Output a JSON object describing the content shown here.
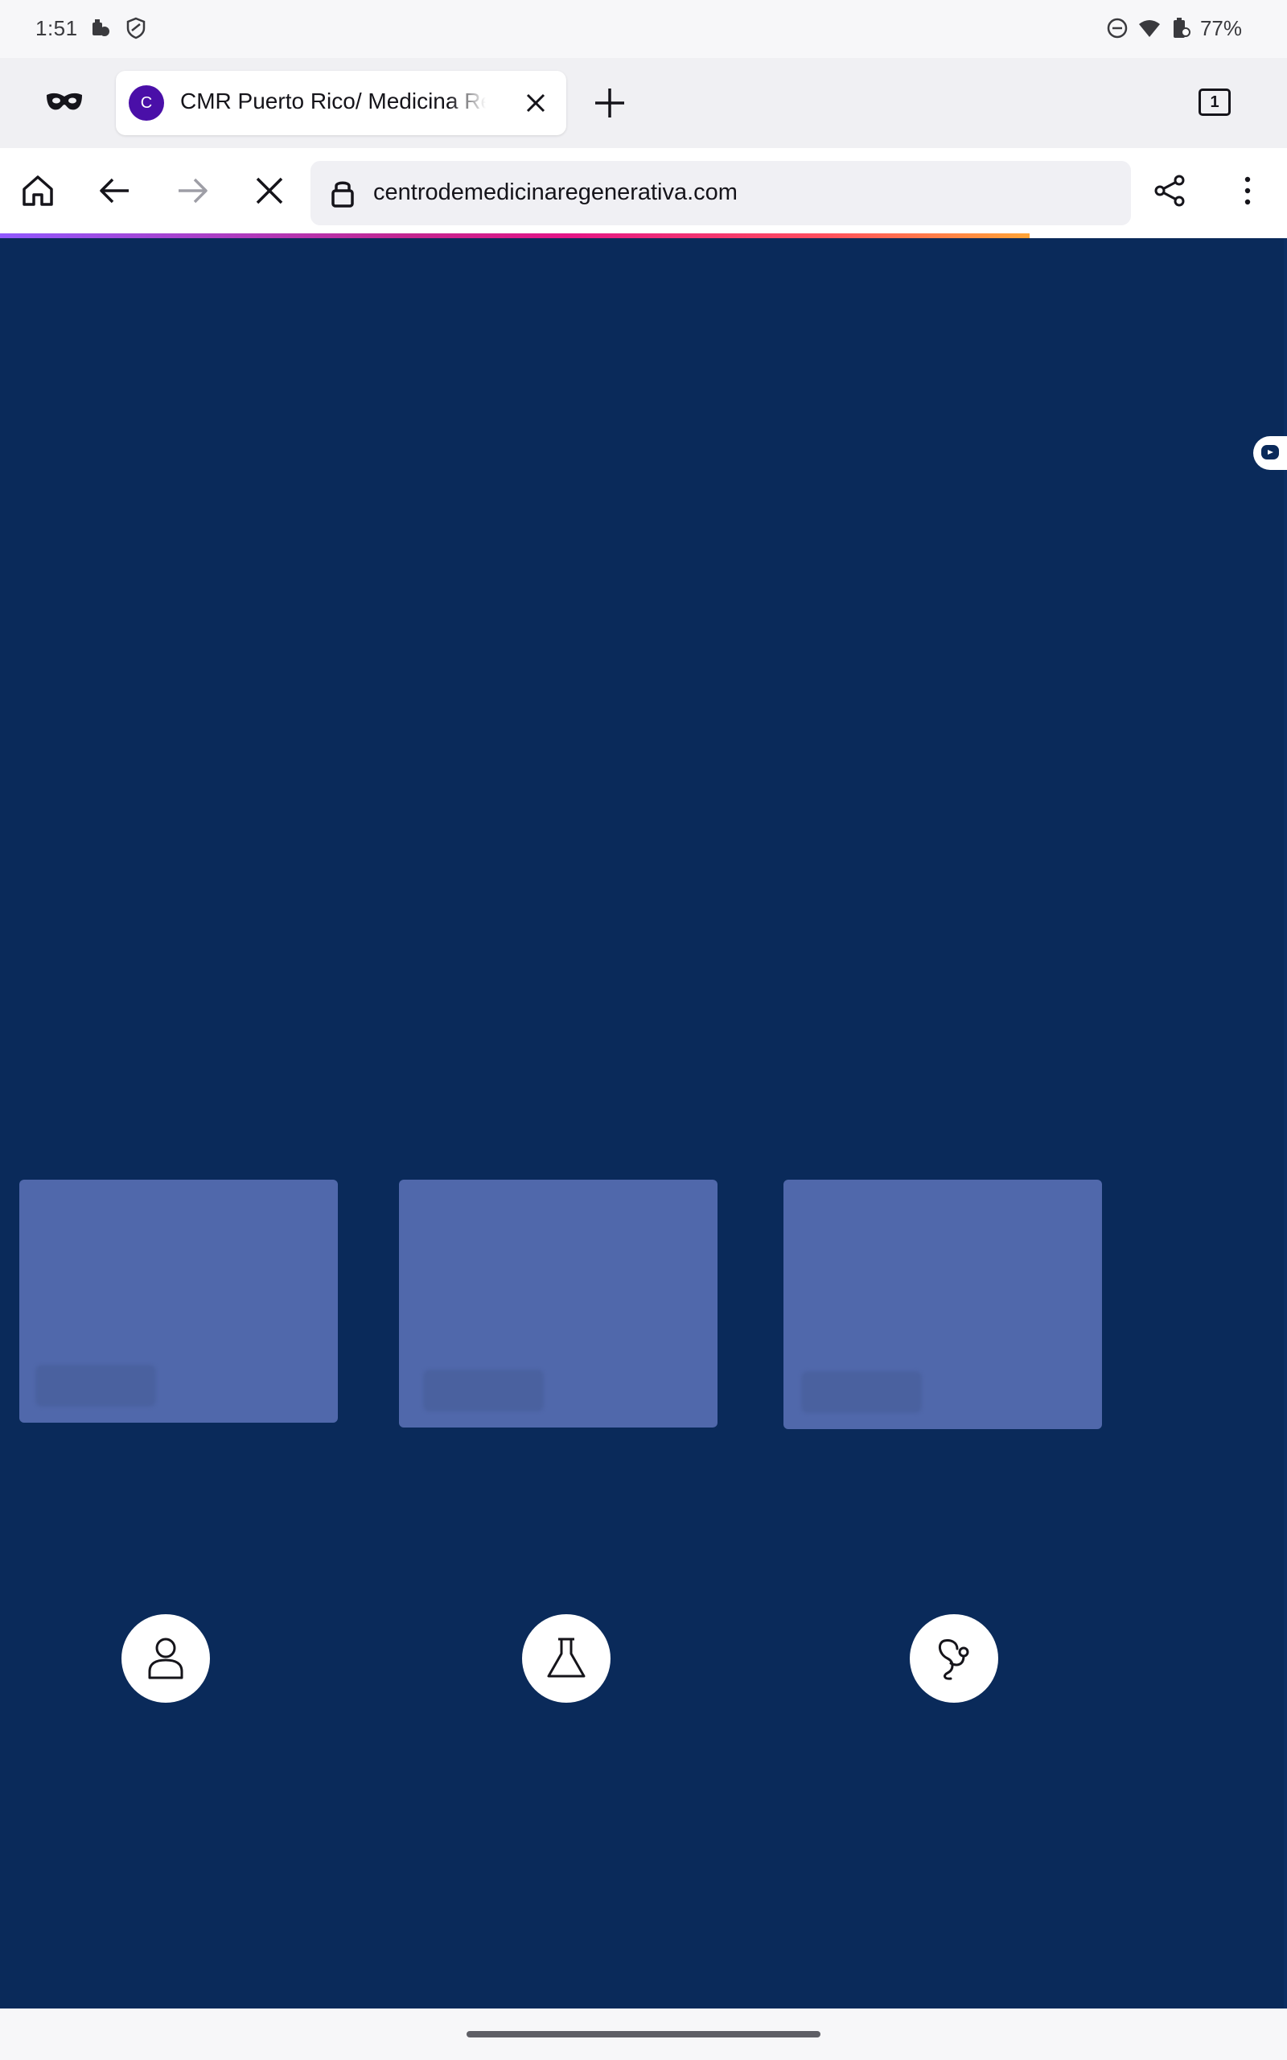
{
  "status_bar": {
    "time": "1:51",
    "battery": "77%",
    "icons": [
      "notification-app-icon",
      "shield-icon",
      "dnd-icon",
      "wifi-icon",
      "battery-icon"
    ]
  },
  "tab_strip": {
    "tab_title": "CMR Puerto Rico/ Medicina Regenerativa",
    "favicon_letter": "C",
    "tab_count": "1"
  },
  "toolbar": {
    "url": "centrodemedicinaregenerativa.com"
  },
  "page": {
    "background_color": "#0a2a5a",
    "card_color": "#5068ab",
    "cards": [
      {
        "name": "card-1"
      },
      {
        "name": "card-2"
      },
      {
        "name": "card-3"
      }
    ],
    "icons": [
      "person-icon",
      "flask-icon",
      "stethoscope-icon"
    ]
  },
  "colors": {
    "favicon": "#4a0fa8",
    "progress_gradient": [
      "#9059ff",
      "#e31587",
      "#ffa436"
    ]
  }
}
